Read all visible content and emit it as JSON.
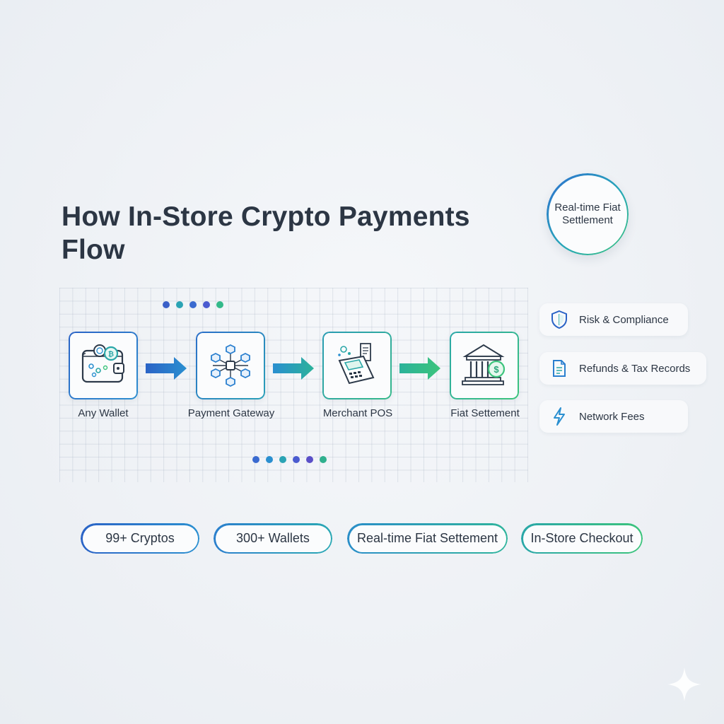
{
  "title": "How In-Store Crypto Payments Flow",
  "badge": "Real-time Fiat Settlement",
  "flow": [
    {
      "label": "Any Wallet",
      "icon": "wallet-icon"
    },
    {
      "label": "Payment Gateway",
      "icon": "network-nodes-icon"
    },
    {
      "label": "Merchant POS",
      "icon": "pos-terminal-icon"
    },
    {
      "label": "Fiat Settement",
      "icon": "bank-icon"
    }
  ],
  "side_items": [
    {
      "label": "Risk & Compliance",
      "icon": "shield-icon"
    },
    {
      "label": "Refunds & Tax Records",
      "icon": "document-icon"
    },
    {
      "label": "Network Fees",
      "icon": "lightning-icon"
    }
  ],
  "pills": [
    "99+ Cryptos",
    "300+ Wallets",
    "Real-time Fiat Settement",
    "In-Store Checkout"
  ],
  "colors": {
    "blue": "#2a63c6",
    "teal": "#2aa7b0",
    "green": "#3cc47c",
    "text": "#2c3644"
  }
}
